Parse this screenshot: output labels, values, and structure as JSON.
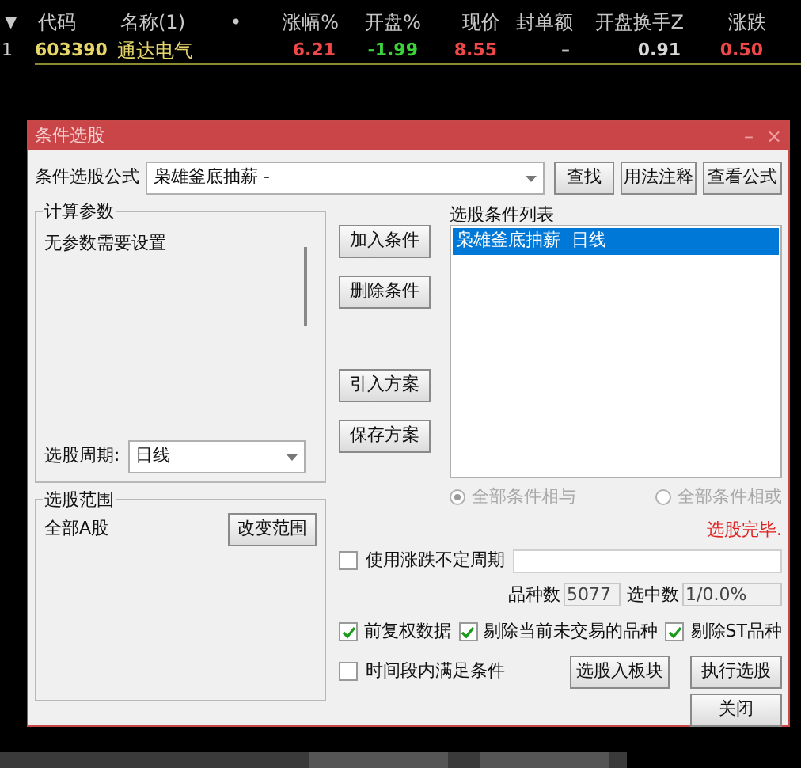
{
  "table": {
    "sort_arrow": "▼",
    "columns": [
      "代码",
      "名称(1)",
      "•",
      "涨幅%",
      "开盘%",
      "现价",
      "封单额",
      "开盘换手Z",
      "涨跌"
    ],
    "rows": [
      {
        "index": "1",
        "cells": [
          {
            "text": "603390",
            "color": "#e6d66a"
          },
          {
            "text": "通达电气",
            "color": "#e6d66a"
          },
          {
            "text": ""
          },
          {
            "text": "6.21",
            "color": "#f04848"
          },
          {
            "text": "-1.99",
            "color": "#3cd23c"
          },
          {
            "text": "8.55",
            "color": "#f04848"
          },
          {
            "text": "–",
            "color": "#c0c0c0"
          },
          {
            "text": "0.91",
            "color": "#d8d8d8"
          },
          {
            "text": "0.50",
            "color": "#f04848"
          }
        ]
      }
    ]
  },
  "dialog": {
    "title": "条件选股",
    "window_buttons": [
      "–",
      "×"
    ],
    "formula": {
      "label": "条件选股公式",
      "value": "枭雄釜底抽薪 -",
      "buttons": [
        "查找",
        "用法注释",
        "查看公式"
      ]
    },
    "params": {
      "title": "计算参数",
      "text": "无参数需要设置",
      "period_label": "选股周期:",
      "period_value": "日线"
    },
    "scope": {
      "title": "选股范围",
      "value": "全部A股",
      "button": "改变范围"
    },
    "actions": [
      "加入条件",
      "删除条件",
      "引入方案",
      "保存方案"
    ],
    "conditions": {
      "title": "选股条件列表",
      "items": [
        {
          "text": "枭雄釜底抽薪  日线",
          "selected": true
        }
      ]
    },
    "logic": [
      {
        "label": "全部条件相与",
        "selected": true
      },
      {
        "label": "全部条件相或",
        "selected": false
      }
    ],
    "status": "选股完毕.",
    "variable_period": {
      "label": "使用涨跌不定周期",
      "checked": false
    },
    "counts": [
      {
        "label": "品种数",
        "value": "5077"
      },
      {
        "label": "选中数",
        "value": "1/0.0%"
      }
    ],
    "options": [
      {
        "label": "前复权数据",
        "checked": true
      },
      {
        "label": "剔除当前未交易的品种",
        "checked": true
      },
      {
        "label": "剔除ST品种",
        "checked": true
      }
    ],
    "time_window": {
      "label": "时间段内满足条件",
      "checked": false
    },
    "buttons": [
      "选股入板块",
      "执行选股",
      "关闭"
    ]
  }
}
